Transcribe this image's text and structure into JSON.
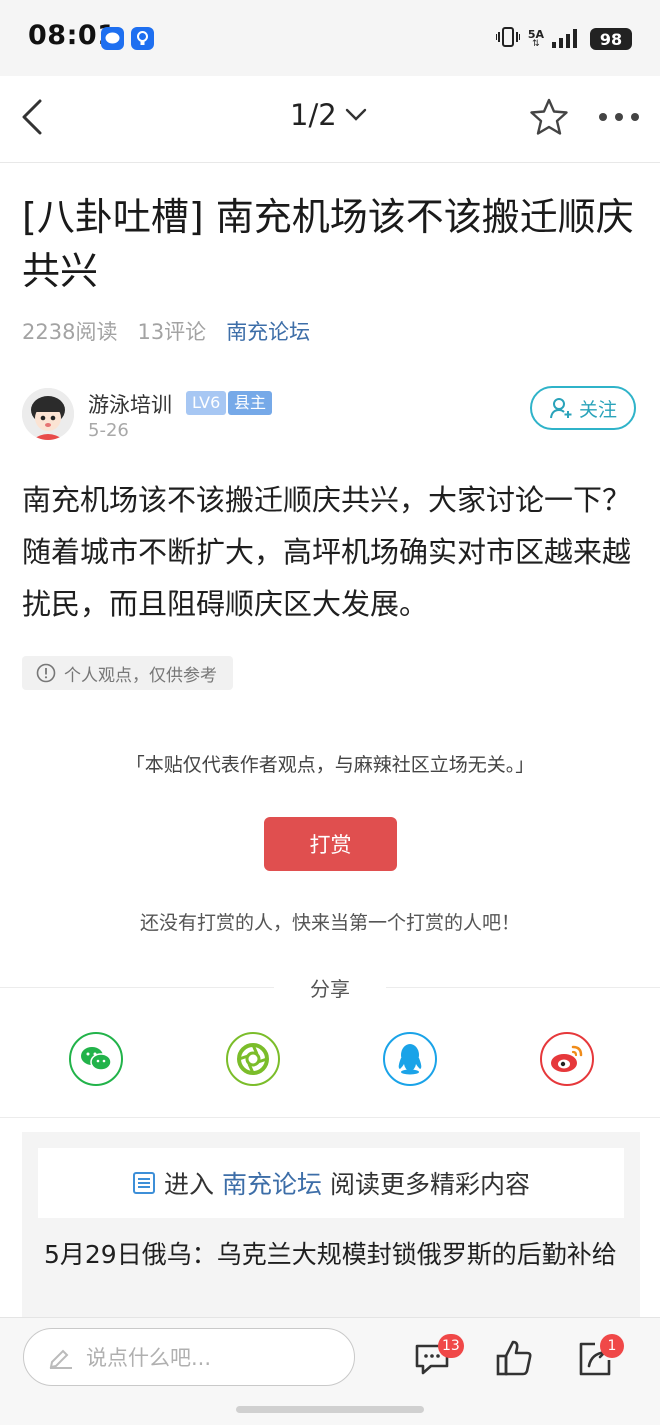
{
  "status_bar": {
    "time": "08:01",
    "network": "5A",
    "battery": "98"
  },
  "nav": {
    "pager": "1/2"
  },
  "post": {
    "title": "[八卦吐槽] 南充机场该不该搬迁顺庆共兴",
    "reads": "2238阅读",
    "comments": "13评论",
    "forum": "南充论坛",
    "author": {
      "name": "游泳培训",
      "level": "LV6",
      "role": "县主",
      "date": "5-26",
      "follow_label": "关注"
    },
    "body": "南充机场该不该搬迁顺庆共兴，大家讨论一下？随着城市不断扩大，高坪机场确实对市区越来越扰民，而且阻碍顺庆区大发展。",
    "opinion_tag": "个人观点，仅供参考",
    "disclaimer": "「本贴仅代表作者观点，与麻辣社区立场无关。」",
    "reward_button": "打赏",
    "reward_note": "还没有打赏的人，快来当第一个打赏的人吧！"
  },
  "share": {
    "label": "分享",
    "targets": [
      "wechat-icon",
      "moments-icon",
      "qq-icon",
      "weibo-icon"
    ],
    "colors": {
      "wechat": "#22b34a",
      "moments": "#7bbd2a",
      "qq": "#1aa3e8",
      "weibo": "#e6383b"
    }
  },
  "related": {
    "enter_prefix": "进入",
    "enter_forum": "南充论坛",
    "enter_suffix": "阅读更多精彩内容",
    "first_title": "5月29日俄乌：乌克兰大规模封锁俄罗斯的后勤补给"
  },
  "bottom_bar": {
    "placeholder": "说点什么吧...",
    "comment_count": "13",
    "share_count": "1"
  },
  "colors": {
    "accent_blue": "#3d6ea8",
    "follow_cyan": "#2fb3c9",
    "reward_red": "#e04f4f",
    "badge_red": "#f04848"
  }
}
